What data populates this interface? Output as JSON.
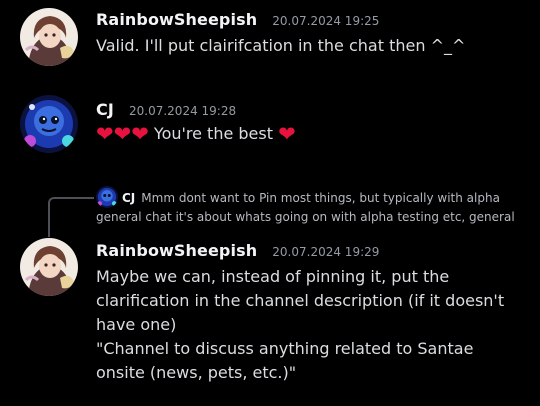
{
  "messages": [
    {
      "author": "RainbowSheepish",
      "timestamp": "20.07.2024 19:25",
      "text": "Valid. I'll put clairifcation in the chat then ^_^"
    },
    {
      "author": "CJ",
      "timestamp": "20.07.2024 19:28",
      "hearts": [
        "❤",
        "❤",
        "❤"
      ],
      "text": "You're the best",
      "trailing_heart": "❤"
    },
    {
      "author": "RainbowSheepish",
      "timestamp": "20.07.2024 19:29",
      "reply": {
        "author": "CJ",
        "line1": "Mmm dont want to Pin most things, but typically with alpha",
        "line2": "general chat it's about whats going on with alpha testing etc, general"
      },
      "lines": [
        "Maybe we can, instead of pinning it, put the",
        "clarification in the channel description (if it doesn't",
        "have one)",
        "\"Channel to discuss anything related to Santae",
        "onsite (news, pets, etc.)\""
      ]
    }
  ],
  "colors": {
    "background": "#000000",
    "username": "#f2f3f5",
    "timestamp": "#949ba4",
    "message_text": "#dbdee1",
    "heart": "#e8123e",
    "reply_text": "#b5bac1"
  },
  "icons": {
    "rainbow_avatar": "anime-character-avatar",
    "cj_avatar": "blue-creature-avatar"
  }
}
